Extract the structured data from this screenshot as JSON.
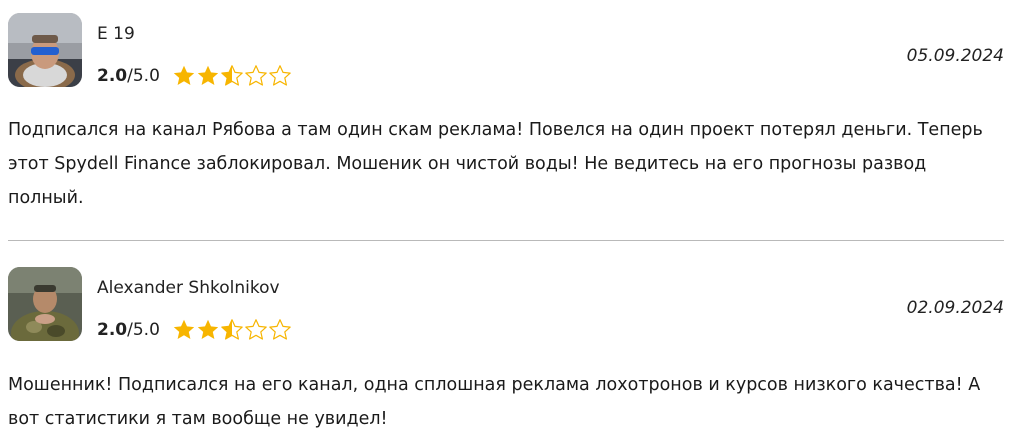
{
  "reviews": [
    {
      "author": "E 19",
      "score": "2.0",
      "max_score": "/5.0",
      "rating": 2.5,
      "date": "05.09.2024",
      "text": "Подписался на канал Рябова а там один скам реклама! Повелся на один проект потерял деньги. Теперь этот Spydell Finance заблокировал. Мошеник он чистой воды! Не ведитесь на его прогнозы развод полный."
    },
    {
      "author": "Alexander Shkolnikov",
      "score": "2.0",
      "max_score": "/5.0",
      "rating": 2.5,
      "date": "02.09.2024",
      "text": "Мошенник! Подписался на его канал, одна сплошная реклама лохотронов и курсов низкого качества! А вот статистики я там вообще не увидел!"
    }
  ],
  "colors": {
    "star_fill": "#f7b500",
    "star_empty_stroke": "#f7b500",
    "divider": "#b9b9b9"
  }
}
